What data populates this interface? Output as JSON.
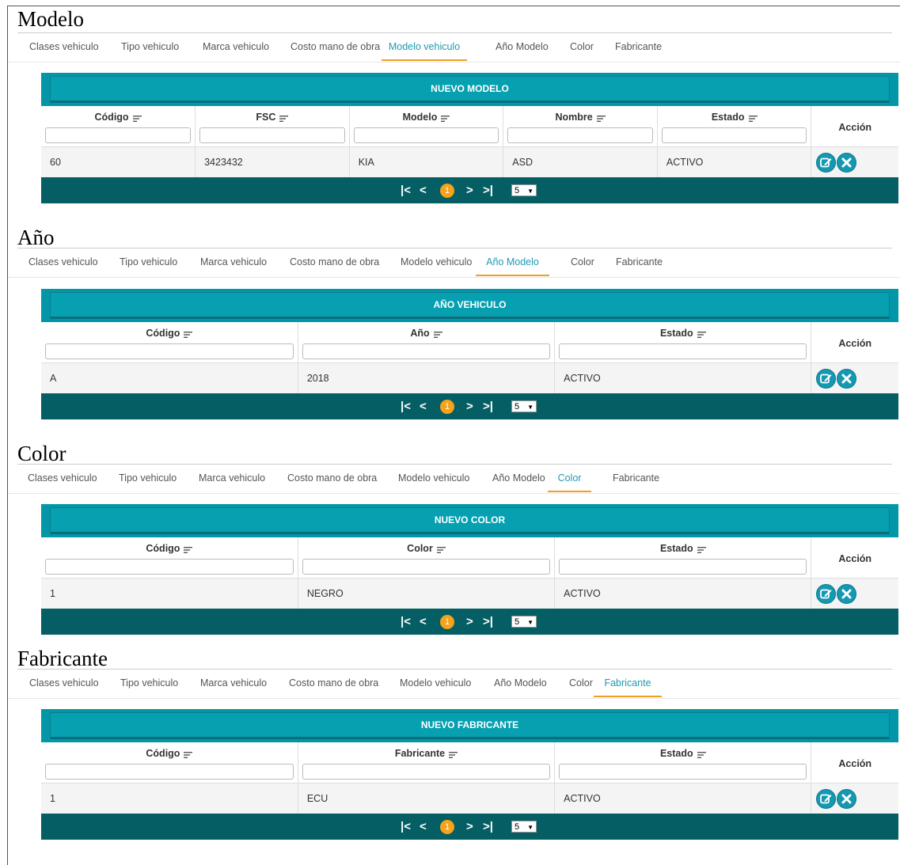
{
  "tabs": [
    "Clases vehiculo",
    "Tipo vehiculo",
    "Marca vehiculo",
    "Costo mano de obra",
    "Modelo vehiculo",
    "Año Modelo",
    "Color",
    "Fabricante"
  ],
  "pager": {
    "first": "|<",
    "prev": "<",
    "current": "1",
    "next": ">",
    "last": ">|",
    "page_size": "5"
  },
  "action_header": "Acción",
  "sections": [
    {
      "heading": "Modelo",
      "active_tab": "Modelo vehiculo",
      "button": "NUEVO MODELO",
      "columns": [
        "Código",
        "FSC",
        "Modelo",
        "Nombre",
        "Estado"
      ],
      "row": [
        "60",
        "3423432",
        "KIA",
        "ASD",
        "ACTIVO"
      ]
    },
    {
      "heading": "Año",
      "active_tab": "Año Modelo",
      "button": "AÑO VEHICULO",
      "columns": [
        "Código",
        "Año",
        "Estado"
      ],
      "row": [
        "A",
        "2018",
        "ACTIVO"
      ]
    },
    {
      "heading": "Color",
      "active_tab": "Color",
      "button": "NUEVO COLOR",
      "columns": [
        "Código",
        "Color",
        "Estado"
      ],
      "row": [
        "1",
        "NEGRO",
        "ACTIVO"
      ]
    },
    {
      "heading": "Fabricante",
      "active_tab": "Fabricante",
      "button": "NUEVO FABRICANTE",
      "columns": [
        "Código",
        "Fabricante",
        "Estado"
      ],
      "row": [
        "1",
        "ECU",
        "ACTIVO"
      ]
    }
  ]
}
